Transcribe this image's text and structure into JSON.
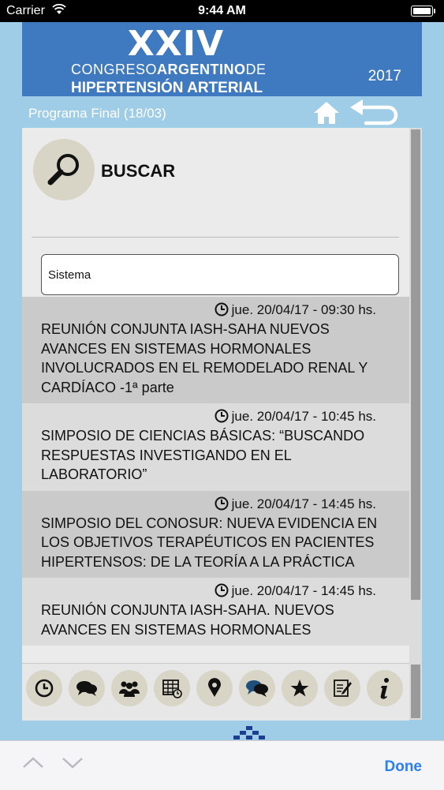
{
  "status": {
    "carrier": "Carrier",
    "time": "9:44 AM"
  },
  "banner": {
    "roman": "XXIV",
    "line1_a": "CONGRESO",
    "line1_b": "ARGENTINO",
    "line1_c": "DE",
    "line2": "HIPERTENSIÓN ARTERIAL",
    "year": "2017"
  },
  "nav": {
    "program_title": "Programa Final (18/03)"
  },
  "search": {
    "heading": "BUSCAR",
    "query": "Sistema"
  },
  "results": [
    {
      "date": "jue. 20/04/17 - 09:30 hs.",
      "title": "REUNIÓN CONJUNTA IASH-SAHA NUEVOS AVANCES EN SISTEMAS HORMONALES INVOLUCRADOS EN EL REMODELADO RENAL Y CARDÍACO -1ª parte"
    },
    {
      "date": "jue. 20/04/17 - 10:45 hs.",
      "title": "SIMPOSIO DE CIENCIAS BÁSICAS: “BUSCANDO RESPUESTAS INVESTIGANDO EN EL LABORATORIO”"
    },
    {
      "date": "jue. 20/04/17 - 14:45 hs.",
      "title": "SIMPOSIO DEL CONOSUR: NUEVA EVIDENCIA EN LOS OBJETIVOS TERAPÉUTICOS EN PACIENTES HIPERTENSOS: DE LA TEORÍA A LA PRÁCTICA"
    },
    {
      "date": "jue. 20/04/17 - 14:45 hs.",
      "title": "REUNIÓN CONJUNTA IASH-SAHA. NUEVOS AVANCES EN SISTEMAS HORMONALES"
    }
  ],
  "tabbar": {
    "icons": [
      "clock-icon",
      "chat-icon",
      "people-icon",
      "calendar-grid-icon",
      "location-pin-icon",
      "speech-bubbles-icon",
      "star-icon",
      "notes-icon",
      "info-icon"
    ]
  },
  "bottom": {
    "done_label": "Done"
  },
  "colors": {
    "banner": "#3f79c0",
    "background": "#9fcce6",
    "done": "#2a7ff3",
    "tab_circle": "#d8d4c6"
  }
}
